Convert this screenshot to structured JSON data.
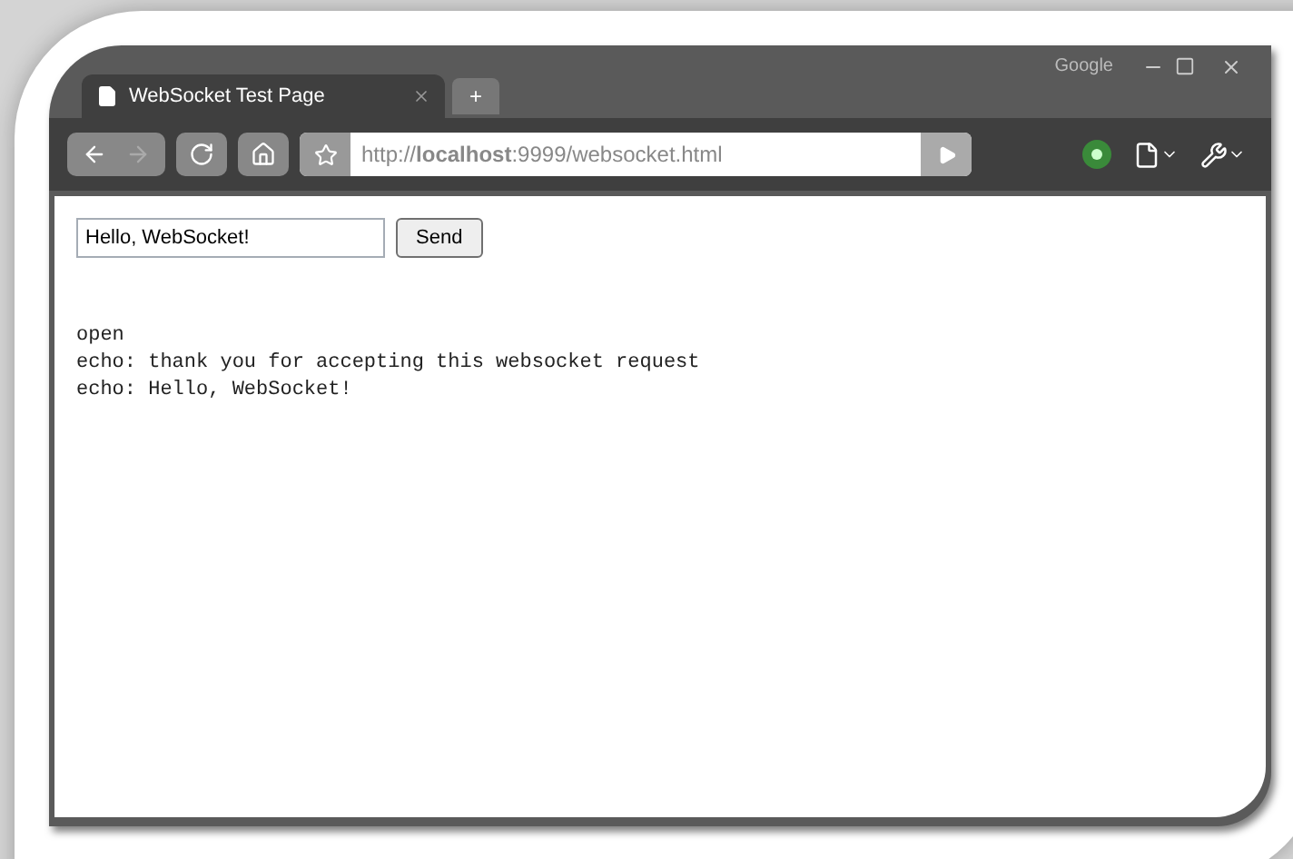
{
  "window": {
    "brand": "Google"
  },
  "tabs": [
    {
      "label": "WebSocket Test Page",
      "selected": true
    }
  ],
  "new_tab": "+",
  "address_bar": {
    "url": "http://**localhost**:9999/websocket.html"
  },
  "form": {
    "message": "Hello, WebSocket!",
    "button": "Send"
  },
  "log": [
    "open",
    "echo: thank you for accepting this websocket request",
    "echo: Hello, WebSocket!"
  ]
}
